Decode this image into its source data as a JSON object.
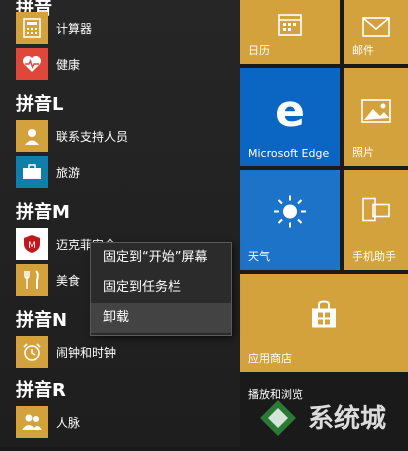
{
  "app_list": {
    "top_header": "拼音",
    "groups": [
      {
        "header": "拼音L"
      },
      {
        "header": "拼音M"
      },
      {
        "header": "拼音N"
      },
      {
        "header": "拼音R"
      }
    ],
    "apps": [
      {
        "label": "计算器",
        "color": "#d4a23c"
      },
      {
        "label": "健康",
        "color": "#e0473b"
      },
      {
        "label": "联系支持人员",
        "color": "#d4a23c"
      },
      {
        "label": "旅游",
        "color": "#0e7fa8"
      },
      {
        "label": "迈克菲安全",
        "color": "#ffffff"
      },
      {
        "label": "美食",
        "color": "#d4a23c"
      },
      {
        "label": "闹钟和时钟",
        "color": "#d4a23c"
      },
      {
        "label": "人脉",
        "color": "#d4a23c"
      }
    ]
  },
  "context_menu": {
    "items": [
      "固定到“开始”屏幕",
      "固定到任务栏",
      "卸载"
    ]
  },
  "tiles": {
    "calendar": {
      "label": "日历",
      "color": "#d4a23c"
    },
    "mail": {
      "label": "邮件",
      "color": "#d4a23c"
    },
    "edge": {
      "label": "Microsoft Edge",
      "color": "#0a66c2"
    },
    "photos": {
      "label": "照片",
      "color": "#d4a23c"
    },
    "weather": {
      "label": "天气",
      "color": "#1d73c7"
    },
    "phone": {
      "label": "手机助手",
      "color": "#d4a23c"
    },
    "store": {
      "label": "应用商店",
      "color": "#d4a23c"
    }
  },
  "section_label": "播放和浏览",
  "watermark": "系统城"
}
